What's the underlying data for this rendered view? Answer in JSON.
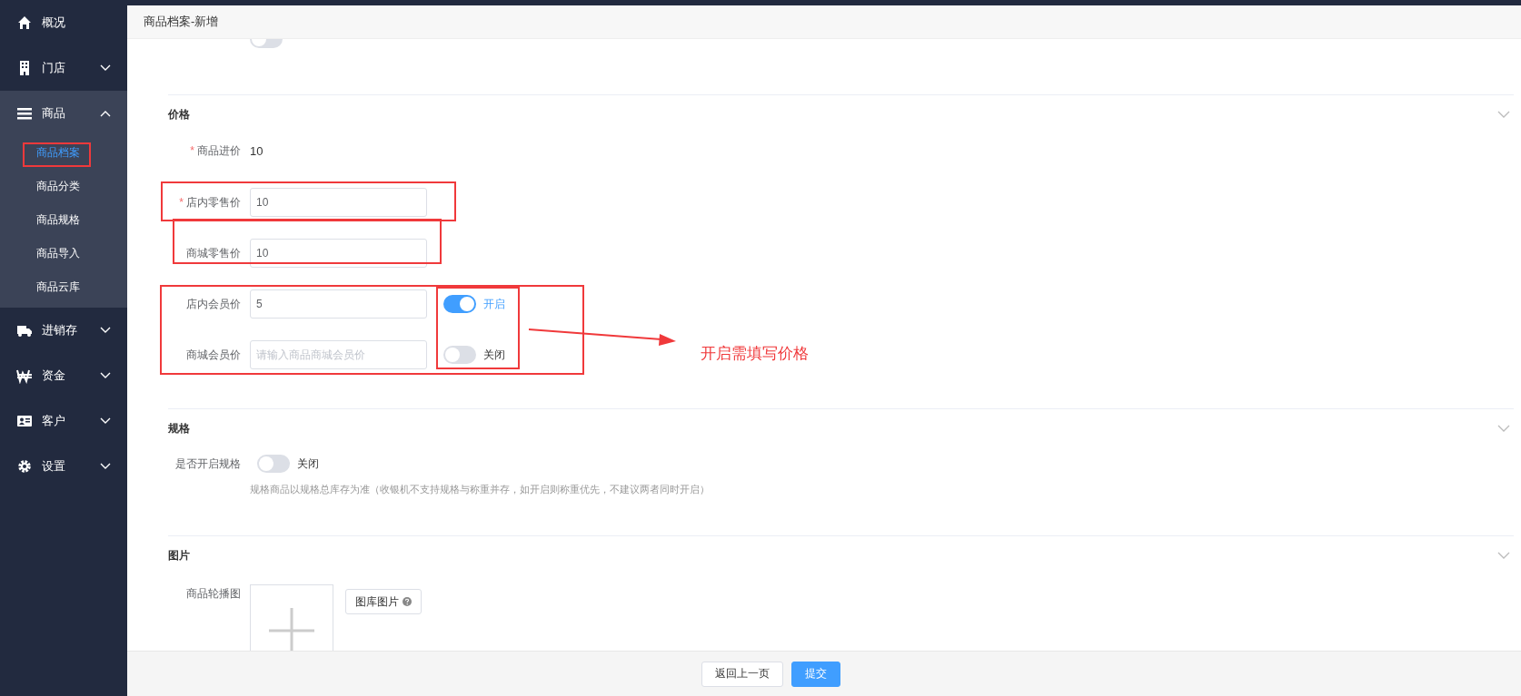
{
  "sidebar": {
    "items": [
      {
        "label": "概况",
        "kind": "link"
      },
      {
        "label": "门店",
        "kind": "group",
        "expanded": false
      },
      {
        "label": "商品",
        "kind": "group",
        "expanded": true,
        "children": [
          {
            "label": "商品档案",
            "selected": true
          },
          {
            "label": "商品分类",
            "selected": false
          },
          {
            "label": "商品规格",
            "selected": false
          },
          {
            "label": "商品导入",
            "selected": false
          },
          {
            "label": "商品云库",
            "selected": false
          }
        ]
      },
      {
        "label": "进销存",
        "kind": "group",
        "expanded": false
      },
      {
        "label": "资金",
        "kind": "group",
        "expanded": false
      },
      {
        "label": "客户",
        "kind": "group",
        "expanded": false
      },
      {
        "label": "设置",
        "kind": "group",
        "expanded": false
      }
    ]
  },
  "header": {
    "title": "商品档案-新增"
  },
  "form": {
    "partial_row": {
      "on": false
    },
    "sections": [
      {
        "title": "价格",
        "fields": [
          {
            "kind": "text",
            "label": "商品进价",
            "required_mark": "*",
            "value": "10"
          },
          {
            "kind": "input",
            "label": "店内零售价",
            "required_mark": "*",
            "value": "10"
          },
          {
            "kind": "input",
            "label": "商城零售价",
            "value": "10"
          },
          {
            "kind": "input",
            "label": "店内会员价",
            "value": "5",
            "toggle": {
              "on": true,
              "label": "开启"
            }
          },
          {
            "kind": "input",
            "label": "商城会员价",
            "placeholder": "请输入商品商城会员价",
            "toggle": {
              "on": false,
              "label": "关闭"
            }
          }
        ]
      },
      {
        "title": "规格",
        "fields": [
          {
            "kind": "switch",
            "label": "是否开启规格",
            "toggle": {
              "on": false,
              "label": "关闭"
            },
            "hint": "规格商品以规格总库存为准（收银机不支持规格与称重并存，如开启则称重优先，不建议两者同时开启）"
          }
        ]
      },
      {
        "title": "图片",
        "fields": [
          {
            "kind": "upload",
            "label": "商品轮播图",
            "button": "图库图片"
          }
        ]
      }
    ]
  },
  "footer": {
    "buttons": [
      {
        "label": "返回上一页",
        "primary": false
      },
      {
        "label": "提交",
        "primary": true
      }
    ]
  },
  "annotation": {
    "note": "开启需填写价格"
  }
}
